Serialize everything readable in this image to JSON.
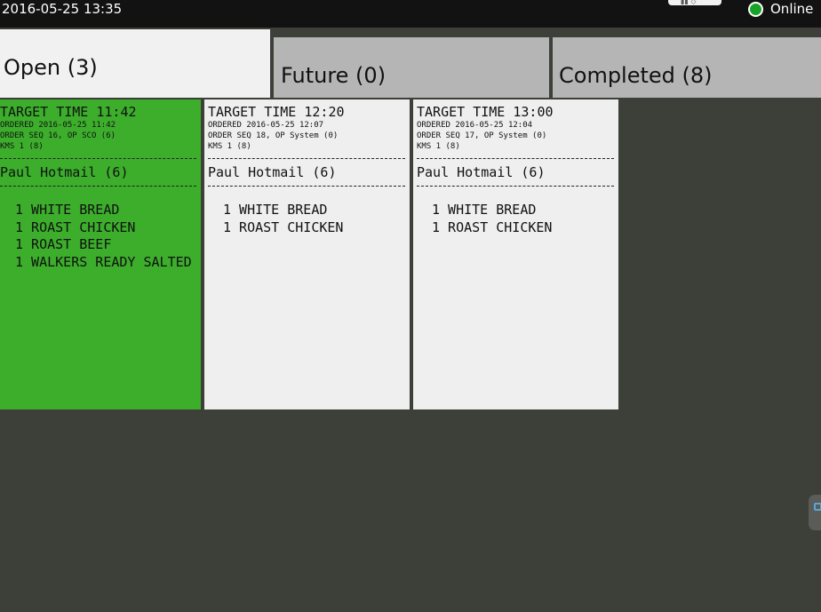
{
  "header": {
    "datetime": "2016-05-25 13:35",
    "status": {
      "label": "Online",
      "color": "#17a326"
    }
  },
  "tabs": [
    {
      "label": "Open (3)",
      "active": true
    },
    {
      "label": "Future (0)",
      "active": false
    },
    {
      "label": "Completed (8)",
      "active": false
    }
  ],
  "colors": {
    "topbar": "#121212",
    "background": "#3d3f39",
    "active_tab": "#f1f1f1",
    "inactive_tab": "#b5b5b5",
    "ticket_highlight": "#3cae2c",
    "ticket_default": "#efefef"
  },
  "tickets": [
    {
      "target": "TARGET TIME 11:42",
      "ordered": "ORDERED 2016-05-25 11:42",
      "order_seq": "ORDER SEQ 16, OP SCO (6)",
      "kms": "KMS 1 (8)",
      "customer": "Paul Hotmail (6)",
      "items": [
        "1 WHITE BREAD",
        "1 ROAST CHICKEN",
        "1 ROAST BEEF",
        "1 WALKERS READY SALTED"
      ]
    },
    {
      "target": "TARGET TIME 12:20",
      "ordered": "ORDERED 2016-05-25 12:07",
      "order_seq": "ORDER SEQ 18, OP System (0)",
      "kms": "KMS 1 (8)",
      "customer": "Paul Hotmail (6)",
      "items": [
        "1 WHITE BREAD",
        "1 ROAST CHICKEN"
      ]
    },
    {
      "target": "TARGET TIME 13:00",
      "ordered": "ORDERED 2016-05-25 12:04",
      "order_seq": "ORDER SEQ 17, OP System (0)",
      "kms": "KMS 1 (8)",
      "customer": "Paul Hotmail (6)",
      "items": [
        "1 WHITE BREAD",
        "1 ROAST CHICKEN"
      ]
    }
  ]
}
